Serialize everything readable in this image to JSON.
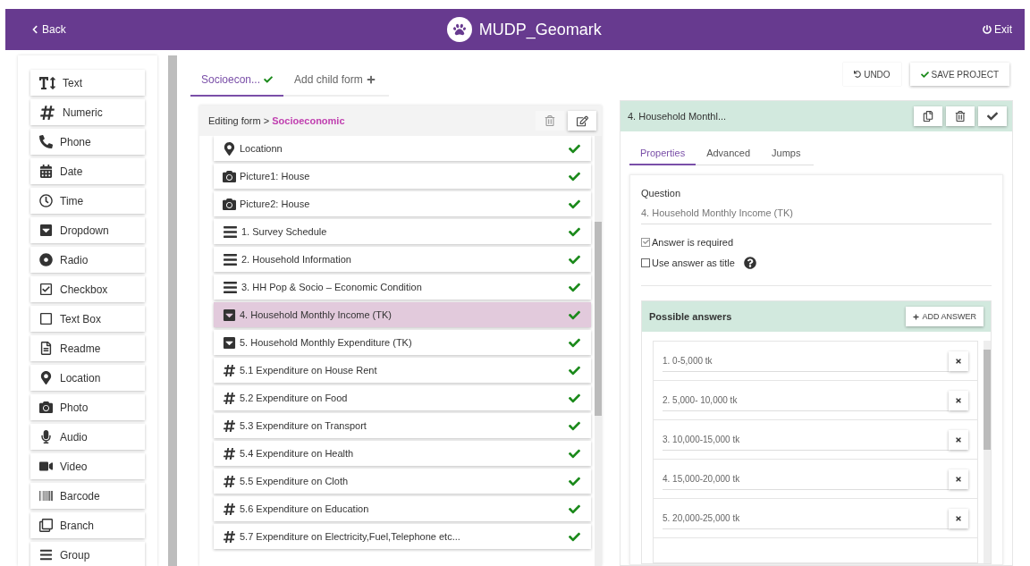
{
  "header": {
    "back": "Back",
    "title": "MUDP_Geomark",
    "exit": "Exit"
  },
  "tools": [
    {
      "kind": "text",
      "label": "Text"
    },
    {
      "kind": "numeric",
      "label": "Numeric"
    },
    {
      "kind": "phone",
      "label": "Phone"
    },
    {
      "kind": "date",
      "label": "Date"
    },
    {
      "kind": "time",
      "label": "Time"
    },
    {
      "kind": "dropdown",
      "label": "Dropdown"
    },
    {
      "kind": "radio",
      "label": "Radio"
    },
    {
      "kind": "checkbox",
      "label": "Checkbox"
    },
    {
      "kind": "textbox",
      "label": "Text Box"
    },
    {
      "kind": "readme",
      "label": "Readme"
    },
    {
      "kind": "location",
      "label": "Location"
    },
    {
      "kind": "photo",
      "label": "Photo"
    },
    {
      "kind": "audio",
      "label": "Audio"
    },
    {
      "kind": "video",
      "label": "Video"
    },
    {
      "kind": "barcode",
      "label": "Barcode"
    },
    {
      "kind": "branch",
      "label": "Branch"
    },
    {
      "kind": "group",
      "label": "Group"
    }
  ],
  "form_tabs": [
    {
      "label": "Socioecon...",
      "kind": "form",
      "selected": true,
      "done": true
    },
    {
      "label": "Add child form",
      "kind": "add",
      "selected": false,
      "done": false
    }
  ],
  "editing": {
    "prefix": "Editing form >",
    "form_name": "Socioeconomic"
  },
  "questions": [
    {
      "kind": "location",
      "label": "Locationn",
      "selected": false,
      "done": true
    },
    {
      "kind": "photo",
      "label": "Picture1: House",
      "selected": false,
      "done": true
    },
    {
      "kind": "photo",
      "label": "Picture2: House",
      "selected": false,
      "done": true
    },
    {
      "kind": "group",
      "label": "1. Survey Schedule",
      "selected": false,
      "done": true
    },
    {
      "kind": "group",
      "label": "2. Household Information",
      "selected": false,
      "done": true
    },
    {
      "kind": "group",
      "label": "3. HH Pop & Socio – Economic Condition",
      "selected": false,
      "done": true
    },
    {
      "kind": "dropdown",
      "label": "4. Household Monthly Income (TK)",
      "selected": true,
      "done": true
    },
    {
      "kind": "dropdown",
      "label": "5. Household Monthly Expenditure (TK)",
      "selected": false,
      "done": true
    },
    {
      "kind": "numeric",
      "label": "5.1 Expenditure on House Rent",
      "selected": false,
      "done": true
    },
    {
      "kind": "numeric",
      "label": "5.2 Expenditure on Food",
      "selected": false,
      "done": true
    },
    {
      "kind": "numeric",
      "label": "5.3 Expenditure on Transport",
      "selected": false,
      "done": true
    },
    {
      "kind": "numeric",
      "label": "5.4 Expenditure on Health",
      "selected": false,
      "done": true
    },
    {
      "kind": "numeric",
      "label": "5.5 Expenditure on Cloth",
      "selected": false,
      "done": true
    },
    {
      "kind": "numeric",
      "label": "5.6 Expenditure on Education",
      "selected": false,
      "done": true
    },
    {
      "kind": "numeric",
      "label": "5.7 Expenditure on Electricity,Fuel,Telephone etc...",
      "selected": false,
      "done": true
    }
  ],
  "actions": {
    "undo": "UNDO",
    "save": "SAVE PROJECT"
  },
  "detail": {
    "title": "4. Household Monthl...",
    "tabs": [
      {
        "label": "Properties",
        "selected": true
      },
      {
        "label": "Advanced",
        "selected": false
      },
      {
        "label": "Jumps",
        "selected": false
      }
    ],
    "question_label": "Question",
    "question_value": "4. Household Monthly Income (TK)",
    "options": [
      {
        "label": "Answer is required",
        "checked": true,
        "help": false
      },
      {
        "label": "Use answer as title",
        "checked": false,
        "help": true
      }
    ],
    "answers_title": "Possible answers",
    "add_answer": "ADD ANSWER",
    "answers": [
      "1. 0-5,000 tk",
      "2. 5,000- 10,000 tk",
      "3. 10,000-15,000 tk",
      "4. 15,000-20,000 tk",
      "5. 20,000-25,000 tk"
    ]
  }
}
